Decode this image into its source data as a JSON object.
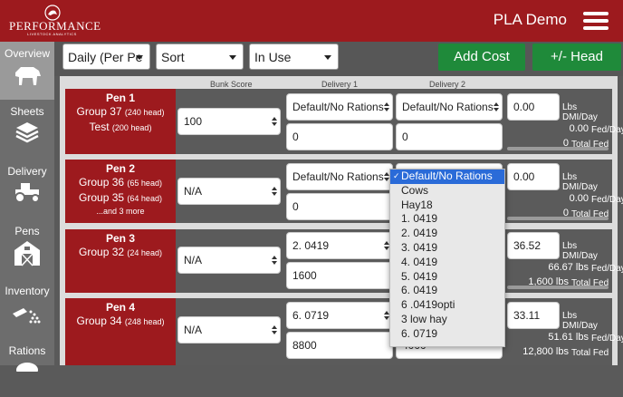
{
  "brand": {
    "logo_text": "PERFORMANCE",
    "logo_sub": "LIVESTOCK ANALYTICS",
    "app_title": "PLA Demo"
  },
  "sidebar": {
    "items": [
      {
        "label": "Overview",
        "icon": "cow-icon"
      },
      {
        "label": "Sheets",
        "icon": "layers-icon"
      },
      {
        "label": "Delivery",
        "icon": "tractor-icon"
      },
      {
        "label": "Pens",
        "icon": "barn-icon"
      },
      {
        "label": "Inventory",
        "icon": "feed-scoop-icon"
      },
      {
        "label": "Rations",
        "icon": "ration-icon"
      }
    ]
  },
  "filters": {
    "period": "Daily (Per Pe",
    "sort": "Sort",
    "status": "In Use"
  },
  "actions": {
    "add_cost": "Add Cost",
    "head": "+/- Head"
  },
  "columns": {
    "bunk_score": "Bunk Score",
    "delivery1": "Delivery 1",
    "delivery2": "Delivery 2"
  },
  "units": {
    "lbs_dmi": "Lbs DMI/Day",
    "fed_day": "Fed/Day",
    "total_fed": "Total Fed"
  },
  "pens": [
    {
      "name": "Pen 1",
      "groups": [
        {
          "name": "Group 37",
          "head": "(240 head)"
        },
        {
          "name": "Test",
          "head": "(200 head)"
        }
      ],
      "more": "",
      "bunk": "100",
      "d1_ration": "Default/No Rations",
      "d1_amount": "0",
      "d2_ration": "Default/No Rations",
      "d2_amount": "0",
      "dmi": "0.00",
      "fed": "0.00",
      "total": "0"
    },
    {
      "name": "Pen 2",
      "groups": [
        {
          "name": "Group 36",
          "head": "(65 head)"
        },
        {
          "name": "Group 35",
          "head": "(64 head)"
        }
      ],
      "more": "...and 3 more",
      "bunk": "N/A",
      "d1_ration": "Default/No Rations",
      "d1_amount": "0",
      "d2_ration": "",
      "d2_amount": "",
      "dmi": "0.00",
      "fed": "0.00",
      "total": "0"
    },
    {
      "name": "Pen 3",
      "groups": [
        {
          "name": "Group 32",
          "head": "(24 head)"
        }
      ],
      "more": "",
      "bunk": "N/A",
      "d1_ration": "2. 0419",
      "d1_amount": "1600",
      "d2_ration": "",
      "d2_amount": "",
      "dmi": "36.52",
      "fed": "66.67 lbs",
      "total": "1,600 lbs"
    },
    {
      "name": "Pen 4",
      "groups": [
        {
          "name": "Group 34",
          "head": "(248 head)"
        }
      ],
      "more": "",
      "bunk": "N/A",
      "d1_ration": "6. 0719",
      "d1_amount": "8800",
      "d2_ration": "",
      "d2_amount": "4000",
      "dmi": "33.11",
      "fed": "51.61 lbs",
      "total": "12,800 lbs"
    }
  ],
  "ration_dropdown": {
    "selected": "Default/No Rations",
    "options": [
      "Default/No Rations",
      "Cows",
      "Hay18",
      "1. 0419",
      "2. 0419",
      "3. 0419",
      "4. 0419",
      "5. 0419",
      "6. 0419",
      "6 .0419opti",
      "3 low hay",
      "6. 0719"
    ]
  },
  "colors": {
    "brand_red": "#9d1a1e",
    "action_green": "#1f8a3a",
    "highlight_blue": "#2a6bd8"
  }
}
